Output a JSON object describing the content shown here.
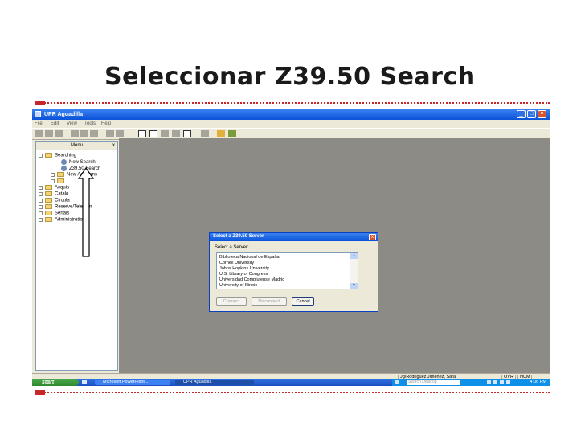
{
  "slide": {
    "title": "Seleccionar Z39.50 Search",
    "accent_color": "#c62828"
  },
  "window": {
    "title": "UPR Aguadilla",
    "menu": [
      "File",
      "Edit",
      "View",
      "Tools",
      "Help"
    ]
  },
  "left_panel": {
    "header": "Menu",
    "close_label": "x",
    "items": [
      {
        "label": "Searching"
      },
      {
        "label": "New Search"
      },
      {
        "label": "Z39.50 Search"
      },
      {
        "label": "New Additions"
      },
      {
        "label": ""
      },
      {
        "label": "Acquis"
      },
      {
        "label": "Catalo"
      },
      {
        "label": "Circula"
      },
      {
        "label": "Reserve/Telecom"
      },
      {
        "label": "Serials"
      },
      {
        "label": "Administration"
      }
    ]
  },
  "dialog": {
    "title": "Select a Z39.50 Server",
    "close_label": "x",
    "label": "Select a Server:",
    "servers": [
      "Biblioteca Nacional de España",
      "Cornell University",
      "Johns Hopkins University",
      "U.S. Library of Congress",
      "Universidad Complutense Madrid",
      "University of Illinois"
    ],
    "buttons": {
      "connect": "Connect",
      "disconnect": "Disconnect",
      "cancel": "Cancel"
    }
  },
  "statusbar": {
    "user": "Jg/Rodriguez Jiménez, Sarai",
    "ovr": "OVR",
    "num": "NUM"
  },
  "taskbar": {
    "start": "start",
    "buttons": [
      "Microsoft PowerPoint ...",
      "UPR Aguadilla"
    ],
    "search_placeholder": "Search Desktop",
    "clock": "4:06 PM"
  }
}
